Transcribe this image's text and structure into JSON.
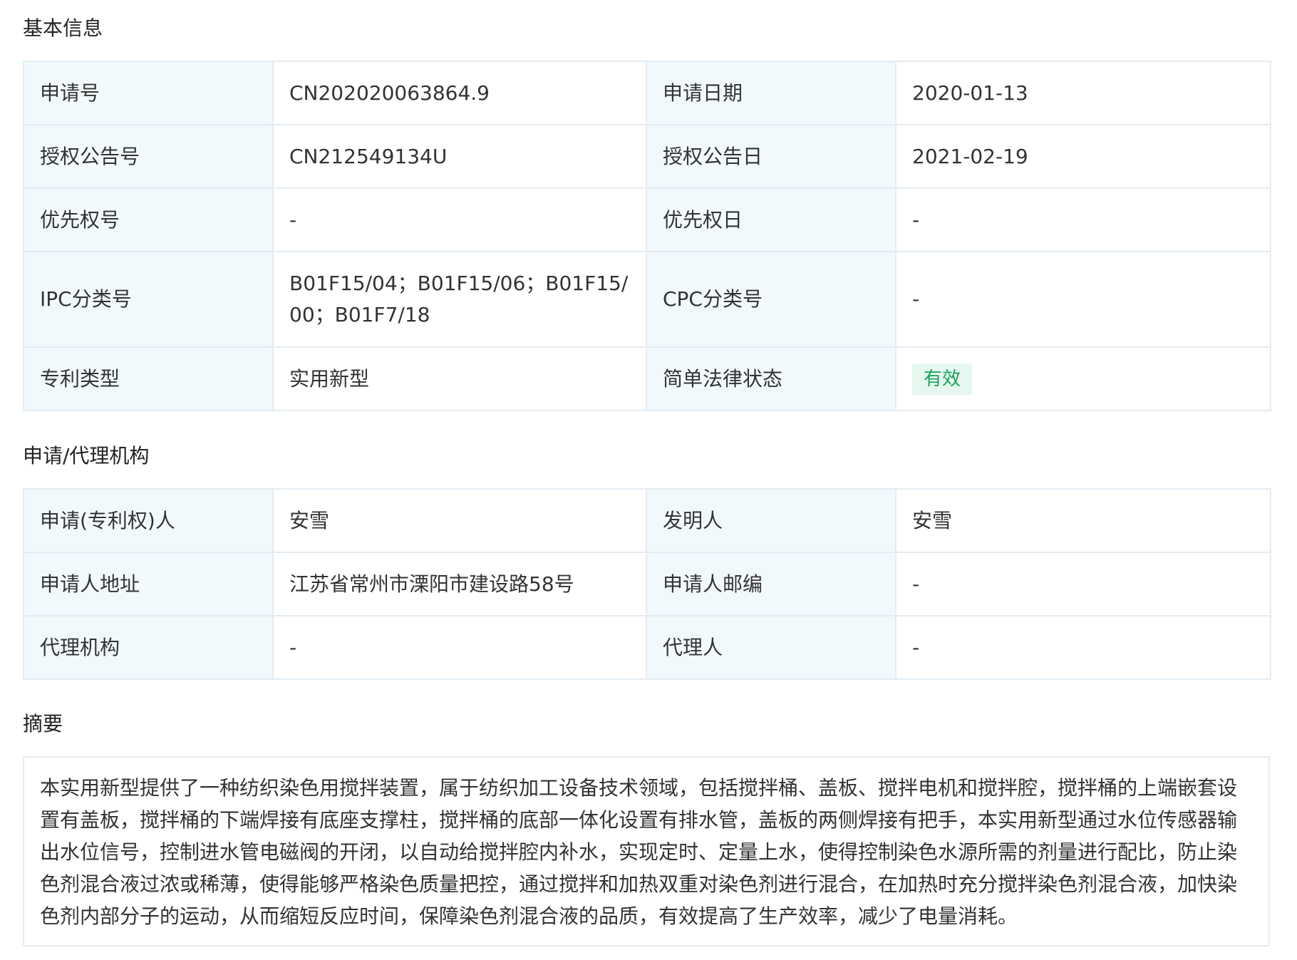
{
  "sections": {
    "basic_info": "基本信息",
    "agency": "申请/代理机构",
    "abstract": "摘要"
  },
  "basic_info": {
    "application_no_label": "申请号",
    "application_no": "CN202020063864.9",
    "application_date_label": "申请日期",
    "application_date": "2020-01-13",
    "grant_pub_no_label": "授权公告号",
    "grant_pub_no": "CN212549134U",
    "grant_pub_date_label": "授权公告日",
    "grant_pub_date": "2021-02-19",
    "priority_no_label": "优先权号",
    "priority_no": "-",
    "priority_date_label": "优先权日",
    "priority_date": "-",
    "ipc_label": "IPC分类号",
    "ipc": "B01F15/04；B01F15/06；B01F15/00；B01F7/18",
    "cpc_label": "CPC分类号",
    "cpc": "-",
    "patent_type_label": "专利类型",
    "patent_type": "实用新型",
    "legal_status_label": "简单法律状态",
    "legal_status": "有效",
    "legal_status_color": "#19a35b"
  },
  "agency": {
    "applicant_label": "申请(专利权)人",
    "applicant": "安雪",
    "inventor_label": "发明人",
    "inventor": "安雪",
    "address_label": "申请人地址",
    "address": "江苏省常州市溧阳市建设路58号",
    "postcode_label": "申请人邮编",
    "postcode": "-",
    "agency_label": "代理机构",
    "agency": "-",
    "agent_label": "代理人",
    "agent": "-"
  },
  "abstract": {
    "text": "本实用新型提供了一种纺织染色用搅拌装置，属于纺织加工设备技术领域，包括搅拌桶、盖板、搅拌电机和搅拌腔，搅拌桶的上端嵌套设置有盖板，搅拌桶的下端焊接有底座支撑柱，搅拌桶的底部一体化设置有排水管，盖板的两侧焊接有把手，本实用新型通过水位传感器输出水位信号，控制进水管电磁阀的开闭，以自动给搅拌腔内补水，实现定时、定量上水，使得控制染色水源所需的剂量进行配比，防止染色剂混合液过浓或稀薄，使得能够严格染色质量把控，通过搅拌和加热双重对染色剂进行混合，在加热时充分搅拌染色剂混合液，加快染色剂内部分子的运动，从而缩短反应时间，保障染色剂混合液的品质，有效提高了生产效率，减少了电量消耗。"
  }
}
